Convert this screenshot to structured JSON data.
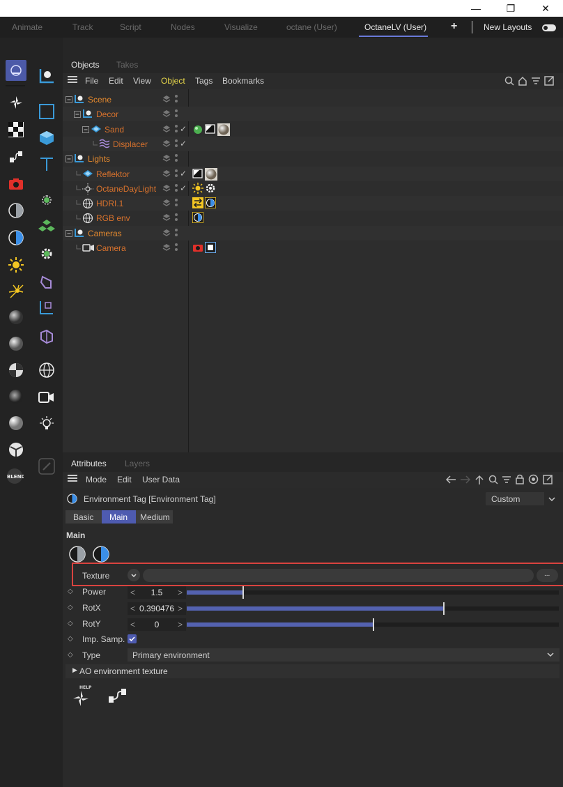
{
  "window": {
    "minimize_glyph": "—",
    "restore_glyph": "❐",
    "close_glyph": "✕"
  },
  "layouts": {
    "tabs": [
      "Animate",
      "Track",
      "Script",
      "Nodes",
      "Visualize",
      "octane (User)",
      "OctaneLV (User)"
    ],
    "active": "OctaneLV (User)",
    "add_glyph": "+",
    "new_layouts": "New Layouts"
  },
  "object_manager": {
    "tabs": [
      "Objects",
      "Takes"
    ],
    "menu": [
      "File",
      "Edit",
      "View",
      "Object",
      "Tags",
      "Bookmarks"
    ],
    "active_menu": "Object",
    "objects": [
      {
        "name": "Scene",
        "check": "",
        "tags": []
      },
      {
        "name": "Decor",
        "check": "",
        "tags": []
      },
      {
        "name": "Sand",
        "check": "✓",
        "tags": [
          "sphere-tag-icon",
          "texture-tag-icon",
          "material-tag-icon"
        ]
      },
      {
        "name": "Displacer",
        "check": "✓",
        "tags": []
      },
      {
        "name": "Lights",
        "check": "",
        "tags": []
      },
      {
        "name": "Reflektor",
        "check": "✓",
        "tags": [
          "texture-tag-icon",
          "material-tag-icon"
        ]
      },
      {
        "name": "OctaneDayLight",
        "check": "✓",
        "tags": [
          "sun-tag-icon",
          "gear-tag-icon"
        ]
      },
      {
        "name": "HDRI.1",
        "check": "",
        "tags": [
          "hdri-tag-icon",
          "environment-tag-icon"
        ]
      },
      {
        "name": "RGB env",
        "check": "",
        "tags": [
          "environment-tag-icon"
        ]
      },
      {
        "name": "Cameras",
        "check": "",
        "tags": []
      },
      {
        "name": "Camera",
        "check": "",
        "tags": [
          "camera-tag-icon",
          "imager-tag-icon"
        ]
      }
    ]
  },
  "attributes": {
    "tabs": [
      "Attributes",
      "Layers"
    ],
    "menu": [
      "Mode",
      "Edit",
      "User Data"
    ],
    "title": "Environment Tag [Environment Tag]",
    "preset": "Custom",
    "sub_tabs": [
      "Basic",
      "Main",
      "Medium"
    ],
    "active_sub_tab": "Main",
    "section": "Main",
    "texture_label": "Texture",
    "texture_button": "...",
    "params": [
      {
        "label": "Power",
        "value": "1.5",
        "fill": 0.15
      },
      {
        "label": "RotX",
        "value": "0.390476",
        "fill": 0.69
      },
      {
        "label": "RotY",
        "value": "0",
        "fill": 0.5
      }
    ],
    "imp_samp_label": "Imp. Samp.",
    "imp_samp_checked": true,
    "type_label": "Type",
    "type_value": "Primary environment",
    "ao_label": "AO environment texture",
    "help_label": "HELP"
  },
  "colors": {
    "accent": "#5462b0",
    "object_name": "#e68a2e",
    "highlight_border": "#d9433f"
  }
}
